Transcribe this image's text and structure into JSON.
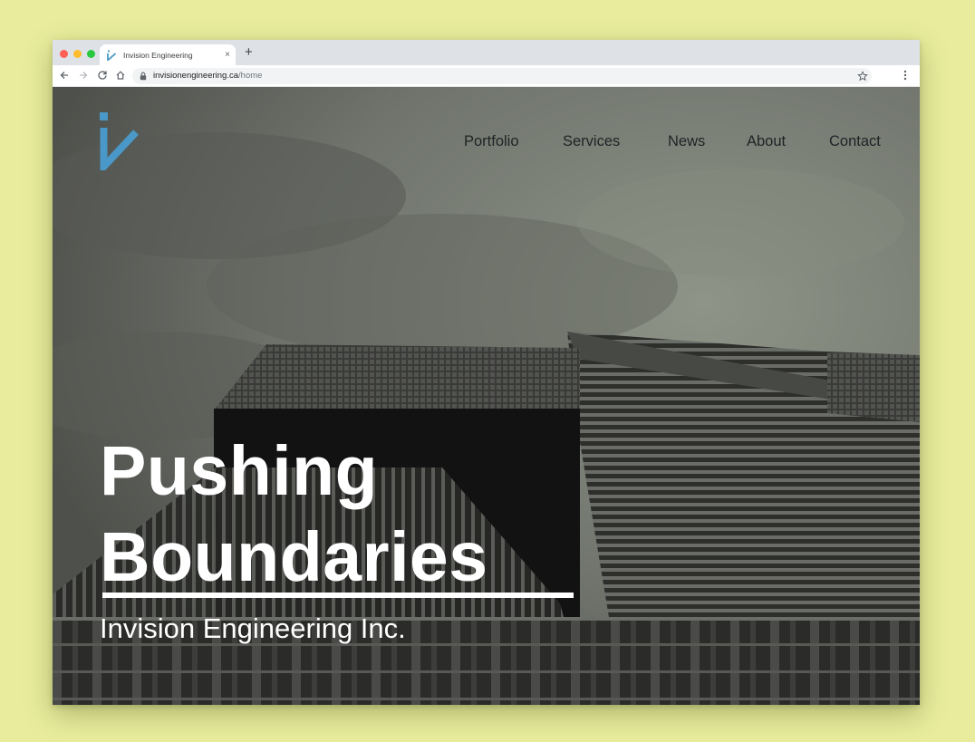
{
  "browser": {
    "tab_title": "Invision Engineering",
    "new_tab_symbol": "+",
    "close_symbol": "×",
    "url_host": "invisionengineering.ca",
    "url_path": "/home",
    "traffic_lights": [
      "#fe5f57",
      "#febc2e",
      "#28c840"
    ]
  },
  "site": {
    "brand_color": "#4a98c7",
    "nav": [
      "Portfolio",
      "Services",
      "News",
      "About",
      "Contact"
    ],
    "hero": {
      "title_line1": "Pushing",
      "title_line2": "Boundaries",
      "subtitle": "Invision Engineering Inc."
    }
  }
}
